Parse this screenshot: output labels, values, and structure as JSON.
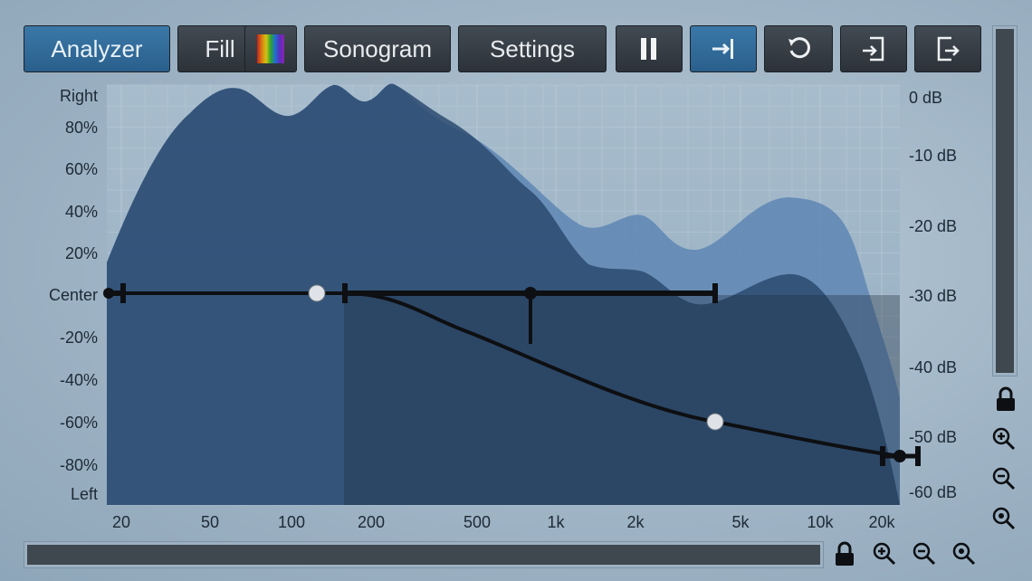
{
  "toolbar": {
    "analyzer": "Analyzer",
    "fill": "Fill",
    "sonogram": "Sonogram",
    "settings": "Settings"
  },
  "y_labels": [
    "Right",
    "80%",
    "60%",
    "40%",
    "20%",
    "Center",
    "-20%",
    "-40%",
    "-60%",
    "-80%",
    "Left"
  ],
  "db_labels": [
    "0 dB",
    "-10 dB",
    "-20 dB",
    "-30 dB",
    "-40 dB",
    "-50 dB",
    "-60 dB"
  ],
  "freq_labels": [
    "20",
    "50",
    "100",
    "200",
    "500",
    "1k",
    "2k",
    "5k",
    "10k",
    "20k"
  ],
  "colors": {
    "accent": "#3173a6",
    "spectrum_back": "#5b82b0",
    "spectrum_front": "#2b4a6e",
    "curve": "#0d0f12"
  },
  "icons": {
    "pause": "pause-icon",
    "stereo": "arrow-to-line-icon",
    "reset": "undo-icon",
    "import": "import-icon",
    "export": "export-icon",
    "lock": "lock-icon",
    "zoom_in": "zoom-in-icon",
    "zoom_out": "zoom-out-icon",
    "zoom_fit": "zoom-fit-icon"
  }
}
